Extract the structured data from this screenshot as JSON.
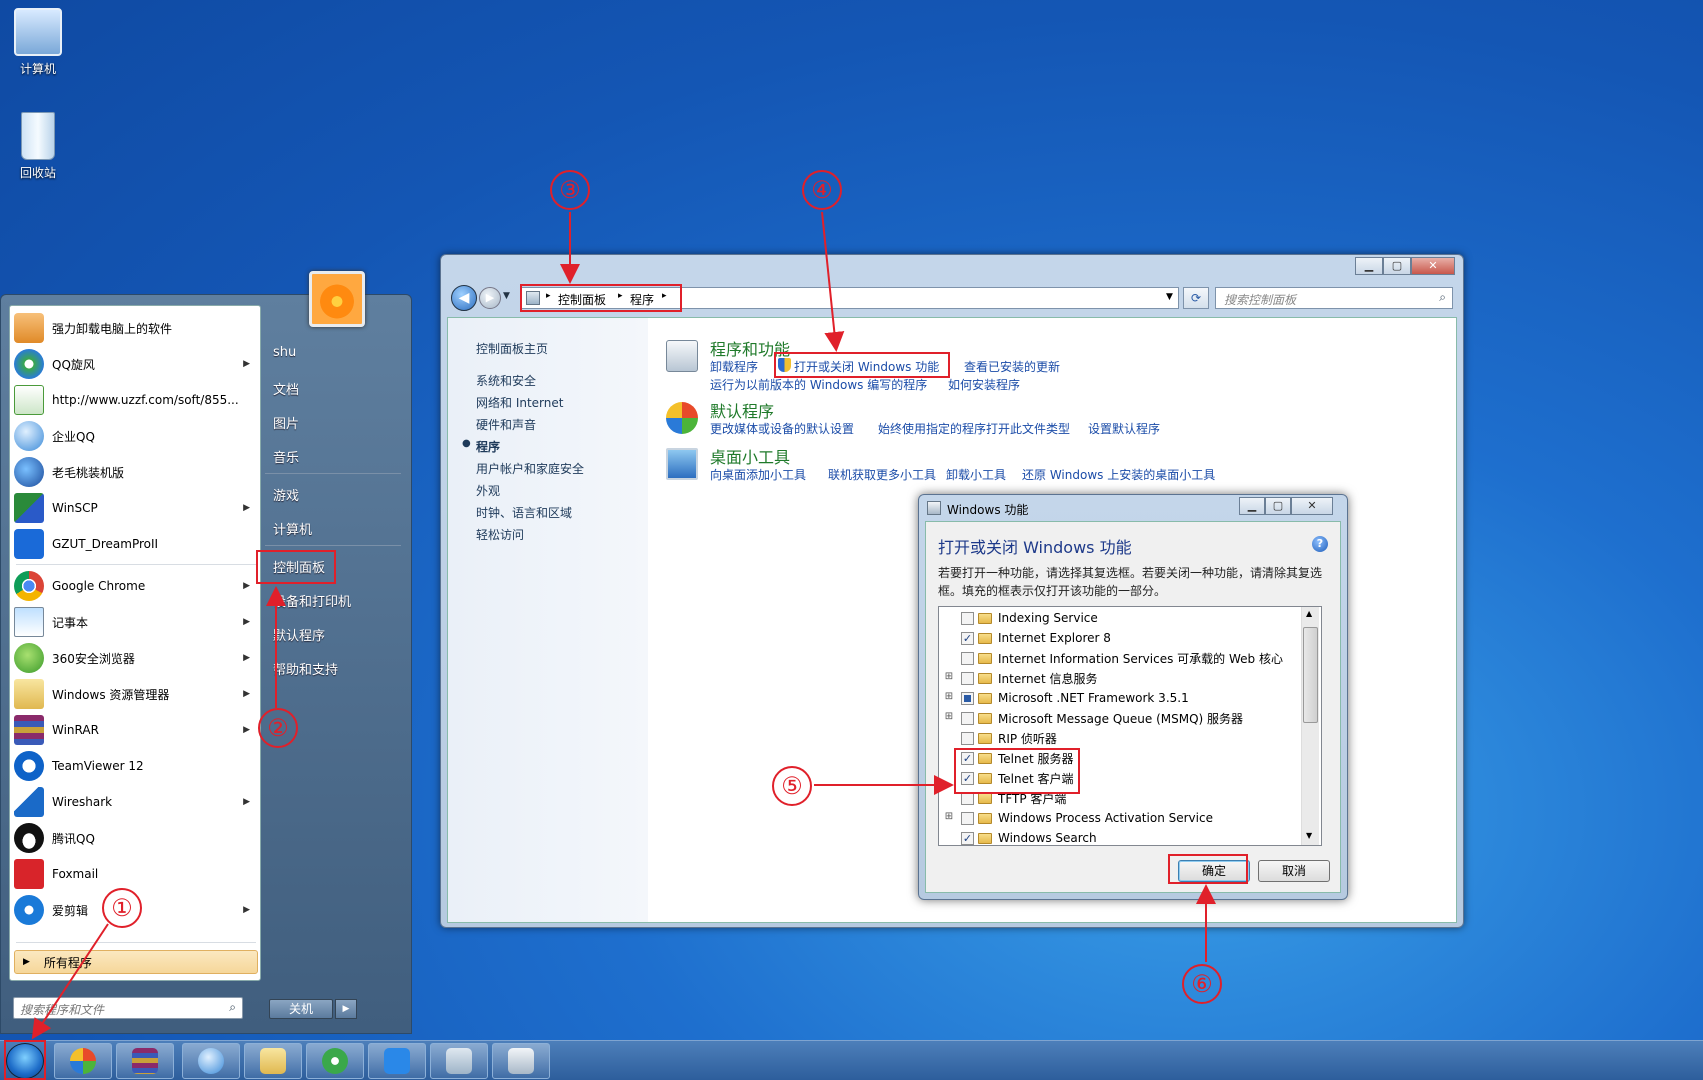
{
  "desktop": {
    "icons": [
      {
        "label": "计算机",
        "icon": "computer-icon"
      },
      {
        "label": "回收站",
        "icon": "recycle-bin-icon"
      }
    ]
  },
  "start_menu": {
    "programs": [
      {
        "label": "强力卸载电脑上的软件",
        "has_arrow": false
      },
      {
        "label": "QQ旋风",
        "has_arrow": true
      },
      {
        "label": "http://www.uzzf.com/soft/855...",
        "has_arrow": false
      },
      {
        "label": "企业QQ",
        "has_arrow": false
      },
      {
        "label": "老毛桃装机版",
        "has_arrow": false
      },
      {
        "label": "WinSCP",
        "has_arrow": true
      },
      {
        "label": "GZUT_DreamProII",
        "has_arrow": false
      },
      {
        "label": "Google Chrome",
        "has_arrow": true
      },
      {
        "label": "记事本",
        "has_arrow": true
      },
      {
        "label": "360安全浏览器",
        "has_arrow": true
      },
      {
        "label": "Windows 资源管理器",
        "has_arrow": true
      },
      {
        "label": "WinRAR",
        "has_arrow": true
      },
      {
        "label": "TeamViewer 12",
        "has_arrow": false
      },
      {
        "label": "Wireshark",
        "has_arrow": true
      },
      {
        "label": "腾讯QQ",
        "has_arrow": false
      },
      {
        "label": "Foxmail",
        "has_arrow": false
      },
      {
        "label": "爱剪辑",
        "has_arrow": true
      }
    ],
    "all_programs": "所有程序",
    "search_placeholder": "搜索程序和文件",
    "right_items": [
      "shu",
      "文档",
      "图片",
      "音乐",
      "游戏",
      "计算机",
      "控制面板",
      "设备和打印机",
      "默认程序",
      "帮助和支持"
    ],
    "shutdown_label": "关机"
  },
  "control_panel": {
    "breadcrumb": [
      "控制面板",
      "程序"
    ],
    "search_placeholder": "搜索控制面板",
    "nav": {
      "home": "控制面板主页",
      "items": [
        "系统和安全",
        "网络和 Internet",
        "硬件和声音",
        "程序",
        "用户帐户和家庭安全",
        "外观",
        "时钟、语言和区域",
        "轻松访问"
      ],
      "current": "程序"
    },
    "categories": [
      {
        "title": "程序和功能",
        "links_row1": [
          "卸载程序",
          "打开或关闭 Windows 功能",
          "查看已安装的更新"
        ],
        "links_row2": [
          "运行为以前版本的 Windows 编写的程序",
          "如何安装程序"
        ]
      },
      {
        "title": "默认程序",
        "links_row1": [
          "更改媒体或设备的默认设置",
          "始终使用指定的程序打开此文件类型",
          "设置默认程序"
        ]
      },
      {
        "title": "桌面小工具",
        "links_row1": [
          "向桌面添加小工具",
          "联机获取更多小工具",
          "卸载小工具",
          "还原 Windows 上安装的桌面小工具"
        ]
      }
    ]
  },
  "features_dialog": {
    "window_title": "Windows 功能",
    "heading": "打开或关闭 Windows 功能",
    "description": "若要打开一种功能，请选择其复选框。若要关闭一种功能，请清除其复选框。填充的框表示仅打开该功能的一部分。",
    "features": [
      {
        "label": "Indexing Service",
        "state": "unchecked",
        "expandable": false
      },
      {
        "label": "Internet Explorer 8",
        "state": "checked",
        "expandable": false
      },
      {
        "label": "Internet Information Services 可承载的 Web 核心",
        "state": "unchecked",
        "expandable": false
      },
      {
        "label": "Internet 信息服务",
        "state": "unchecked",
        "expandable": true
      },
      {
        "label": "Microsoft .NET Framework 3.5.1",
        "state": "partial",
        "expandable": true
      },
      {
        "label": "Microsoft Message Queue (MSMQ) 服务器",
        "state": "unchecked",
        "expandable": true
      },
      {
        "label": "RIP 侦听器",
        "state": "unchecked",
        "expandable": false
      },
      {
        "label": "Telnet 服务器",
        "state": "checked",
        "expandable": false
      },
      {
        "label": "Telnet 客户端",
        "state": "checked",
        "expandable": false
      },
      {
        "label": "TFTP 客户端",
        "state": "unchecked",
        "expandable": false
      },
      {
        "label": "Windows Process Activation Service",
        "state": "unchecked",
        "expandable": true
      },
      {
        "label": "Windows Search",
        "state": "checked",
        "expandable": false
      }
    ],
    "ok_label": "确定",
    "cancel_label": "取消"
  },
  "annotations": [
    "①",
    "②",
    "③",
    "④",
    "⑤",
    "⑥"
  ],
  "colors": {
    "annotation": "#e0202a",
    "link": "#1b4ca8",
    "category_title": "#1f7a2a"
  }
}
